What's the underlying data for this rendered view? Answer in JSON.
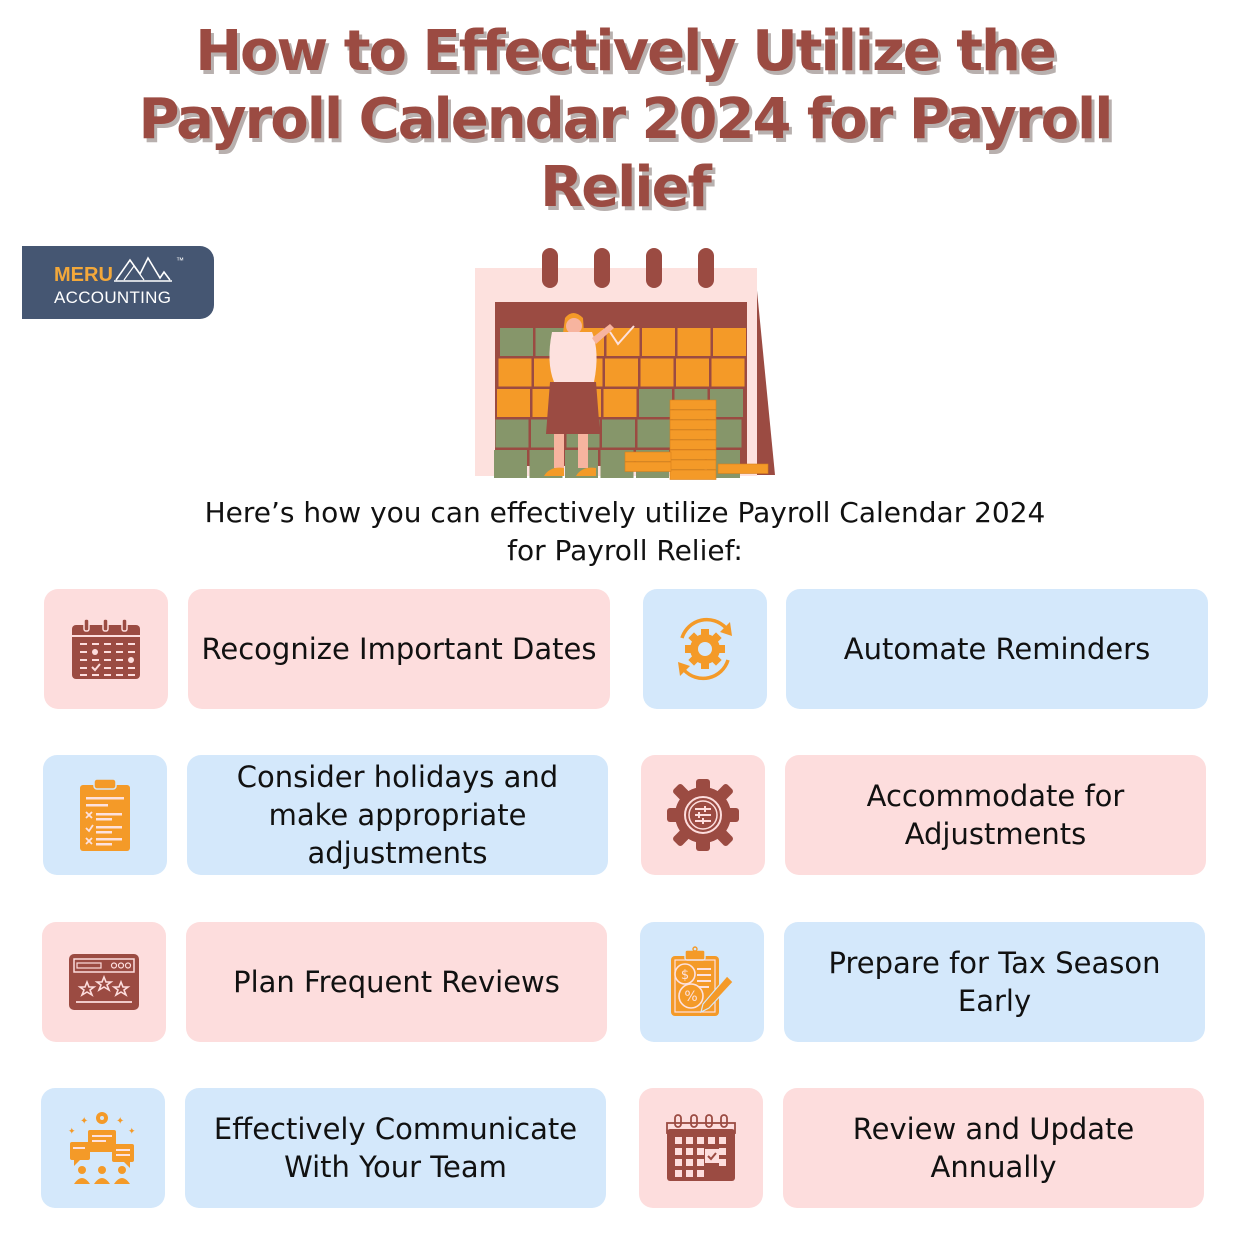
{
  "title": "How to Effectively Utilize the Payroll Calendar 2024 for Payroll Relief",
  "title_lines": [
    "How to Effectively Utilize the",
    "Payroll Calendar 2024 for Payroll",
    "Relief"
  ],
  "logo": {
    "brand": "MERU",
    "sub": "ACCOUNTING",
    "tm": "™",
    "icon": "mountain-peaks-icon"
  },
  "hero_illustration": "woman-marking-large-desk-calendar-with-coin-stacks",
  "intro_lines": [
    "Here’s how you can effectively utilize Payroll Calendar 2024",
    "for Payroll Relief:"
  ],
  "colors": {
    "title": "#9b4b42",
    "pink_card": "#fddddd",
    "blue_card": "#d4e8fb",
    "icon_brown": "#9b4b42",
    "icon_orange": "#f49a28",
    "logo_bg": "#455672",
    "logo_accent": "#f3a83a"
  },
  "tips": [
    {
      "label": "Recognize Important Dates",
      "icon": "calendar-dates-icon",
      "theme": "pink"
    },
    {
      "label": "Automate Reminders",
      "icon": "gear-cycle-icon",
      "theme": "blue"
    },
    {
      "label": "Consider holidays and make appropriate adjustments",
      "icon": "clipboard-checklist-icon",
      "theme": "blue"
    },
    {
      "label": "Accommodate for Adjustments",
      "icon": "gear-settings-icon",
      "theme": "pink"
    },
    {
      "label": "Plan Frequent Reviews",
      "icon": "browser-stars-icon",
      "theme": "pink"
    },
    {
      "label": "Prepare for Tax Season Early",
      "icon": "tax-clipboard-icon",
      "theme": "blue"
    },
    {
      "label": "Effectively Communicate With Your Team",
      "icon": "team-chat-icon",
      "theme": "blue"
    },
    {
      "label": "Review and Update Annually",
      "icon": "calendar-check-icon",
      "theme": "pink"
    }
  ]
}
